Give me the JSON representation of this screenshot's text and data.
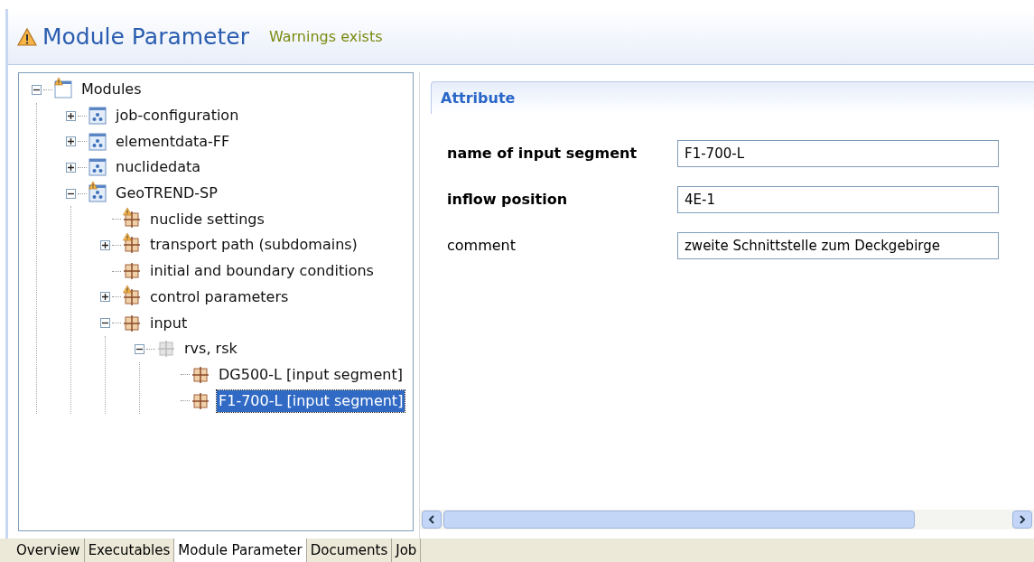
{
  "header": {
    "title": "Module Parameter",
    "status": "Warnings exists",
    "warning": true
  },
  "tree": [
    {
      "label": "Modules",
      "kind": "root",
      "warning": true,
      "expanded": true,
      "children": [
        {
          "label": "job-configuration",
          "kind": "module",
          "warning": false,
          "expanded": false
        },
        {
          "label": "elementdata-FF",
          "kind": "module",
          "warning": false,
          "expanded": false
        },
        {
          "label": "nuclidedata",
          "kind": "module",
          "warning": false,
          "expanded": false
        },
        {
          "label": "GeoTREND-SP",
          "kind": "module",
          "warning": true,
          "expanded": true,
          "children": [
            {
              "label": "nuclide settings",
              "kind": "block",
              "warning": true,
              "selected": false
            },
            {
              "label": "transport path (subdomains)",
              "kind": "block",
              "warning": true,
              "expanded": false
            },
            {
              "label": "initial and boundary conditions",
              "kind": "block",
              "warning": false,
              "selected": false
            },
            {
              "label": "control parameters",
              "kind": "block",
              "warning": true,
              "expanded": false
            },
            {
              "label": "input",
              "kind": "block",
              "warning": false,
              "expanded": true,
              "children": [
                {
                  "label": "rvs, rsk",
                  "kind": "group",
                  "warning": false,
                  "expanded": true,
                  "children": [
                    {
                      "label": "DG500-L [input segment]",
                      "kind": "block",
                      "warning": false,
                      "selected": false
                    },
                    {
                      "label": "F1-700-L [input segment]",
                      "kind": "block",
                      "warning": false,
                      "selected": true
                    }
                  ]
                }
              ]
            }
          ]
        }
      ]
    }
  ],
  "attribute": {
    "title": "Attribute",
    "fields": [
      {
        "label": "name of input segment",
        "required": true,
        "value": "F1-700-L"
      },
      {
        "label": "inflow position",
        "required": true,
        "value": "4E-1"
      },
      {
        "label": "comment",
        "required": false,
        "value": "zweite Schnittstelle zum Deckgebirge"
      }
    ]
  },
  "tabs": [
    {
      "label": "Overview",
      "selected": false
    },
    {
      "label": "Executables",
      "selected": false
    },
    {
      "label": "Module Parameter",
      "selected": true
    },
    {
      "label": "Documents",
      "selected": false
    },
    {
      "label": "Job",
      "selected": false
    }
  ]
}
